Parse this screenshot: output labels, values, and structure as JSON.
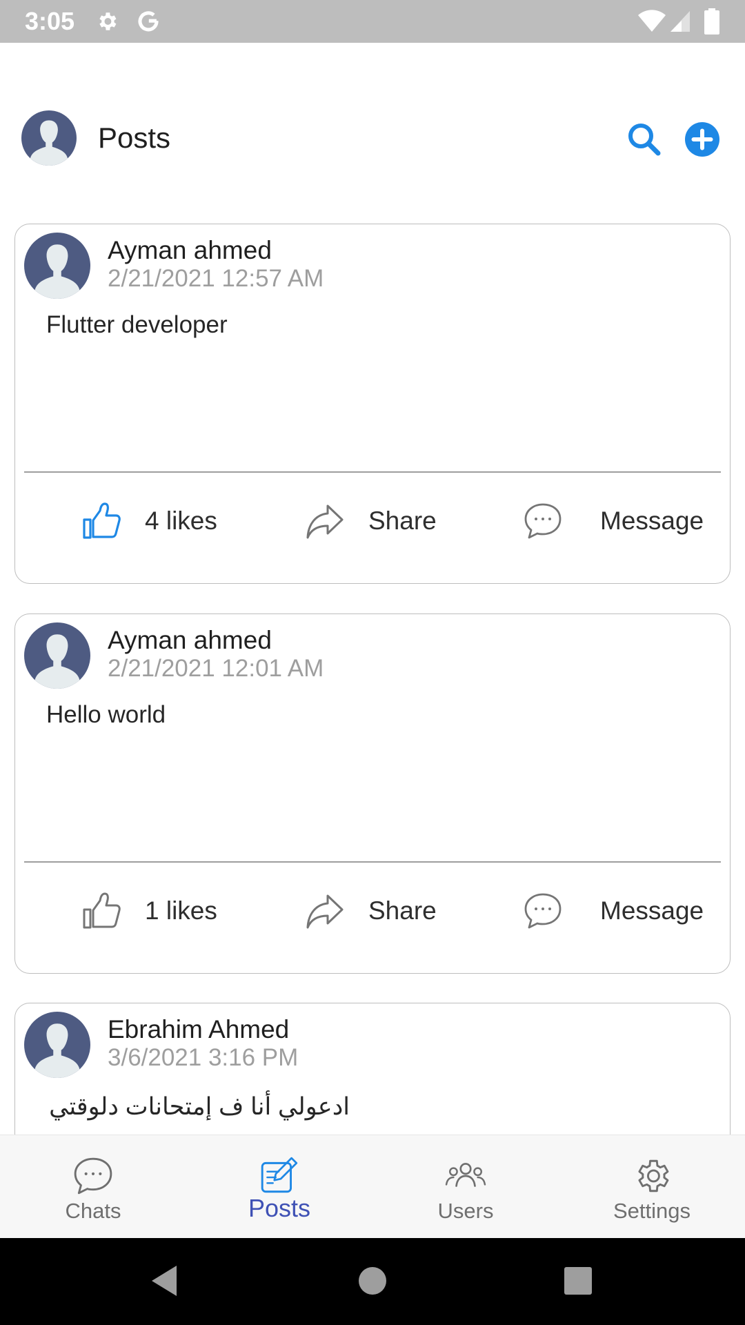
{
  "status_bar": {
    "time": "3:05",
    "icons": [
      "settings-icon",
      "google-icon",
      "wifi-icon",
      "signal-icon",
      "battery-icon"
    ]
  },
  "app_bar": {
    "title": "Posts",
    "actions": [
      "search-icon",
      "add-circle-icon"
    ],
    "accent_color": "#1e88e5"
  },
  "posts": [
    {
      "author": "Ayman ahmed",
      "time": "2/21/2021 12:57 AM",
      "text": "Flutter developer",
      "likes_label": "4 likes",
      "liked": true,
      "share_label": "Share",
      "message_label": "Message"
    },
    {
      "author": "Ayman ahmed",
      "time": "2/21/2021 12:01 AM",
      "text": "Hello world",
      "likes_label": "1 likes",
      "liked": false,
      "share_label": "Share",
      "message_label": "Message"
    },
    {
      "author": "Ebrahim Ahmed",
      "time": "3/6/2021 3:16 PM",
      "text": "ادعولي أنا ف إمتحانات دلوقتي"
    }
  ],
  "bottom_nav": {
    "items": [
      {
        "label": "Chats",
        "icon": "chat-bubble-icon",
        "active": false
      },
      {
        "label": "Posts",
        "icon": "edit-note-icon",
        "active": true
      },
      {
        "label": "Users",
        "icon": "group-icon",
        "active": false
      },
      {
        "label": "Settings",
        "icon": "gear-icon",
        "active": false
      }
    ],
    "active_color": "#3f51b5"
  },
  "system_nav": [
    "back-icon",
    "home-icon",
    "recents-icon"
  ]
}
